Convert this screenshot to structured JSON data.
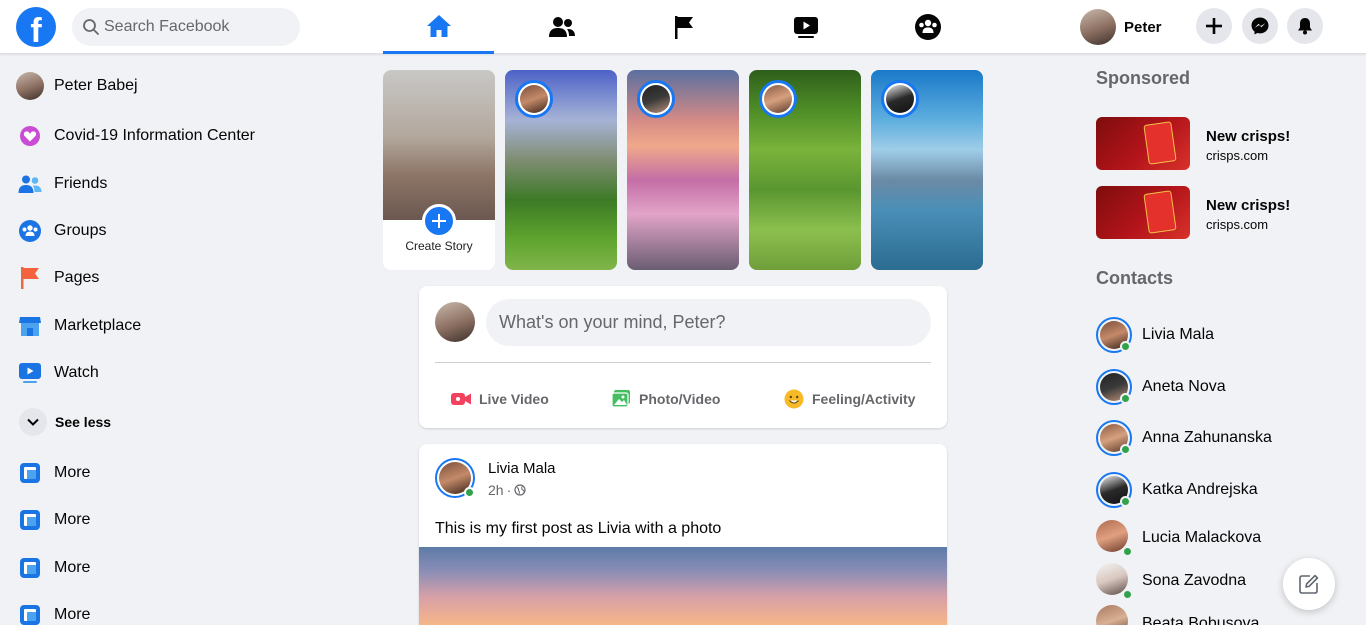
{
  "header": {
    "logo": "f",
    "search_placeholder": "Search Facebook",
    "nav_tabs": [
      {
        "icon": "home-icon",
        "active": true
      },
      {
        "icon": "friends-icon",
        "active": false
      },
      {
        "icon": "pages-flag-icon",
        "active": false
      },
      {
        "icon": "watch-icon",
        "active": false
      },
      {
        "icon": "groups-icon",
        "active": false
      }
    ],
    "profile_name": "Peter",
    "buttons": [
      "create-plus-icon",
      "messenger-icon",
      "notifications-bell-icon"
    ]
  },
  "sidebar": {
    "items": [
      {
        "label": "Peter Babej",
        "icon": "profile-avatar"
      },
      {
        "label": "Covid-19 Information Center",
        "icon": "covid-heart-icon"
      },
      {
        "label": "Friends",
        "icon": "friends-icon"
      },
      {
        "label": "Groups",
        "icon": "groups-icon"
      },
      {
        "label": "Pages",
        "icon": "pages-flag-icon"
      },
      {
        "label": "Marketplace",
        "icon": "marketplace-store-icon"
      },
      {
        "label": "Watch",
        "icon": "watch-icon"
      }
    ],
    "see_less": "See less",
    "more_items": [
      "More",
      "More",
      "More",
      "More"
    ]
  },
  "stories": {
    "create_label": "Create Story"
  },
  "composer": {
    "placeholder": "What's on your mind, Peter?",
    "actions": [
      "Live Video",
      "Photo/Video",
      "Feeling/Activity"
    ]
  },
  "post": {
    "author": "Livia Mala",
    "time": "2h",
    "text": "This is my first post as Livia with a photo"
  },
  "right": {
    "sponsored_heading": "Sponsored",
    "ads": [
      {
        "title": "New crisps!",
        "domain": "crisps.com"
      },
      {
        "title": "New crisps!",
        "domain": "crisps.com"
      }
    ],
    "contacts_heading": "Contacts",
    "contacts": [
      "Livia Mala",
      "Aneta Nova",
      "Anna Zahunanska",
      "Katka Andrejska",
      "Lucia Malackova",
      "Sona Zavodna",
      "Beata Bobusova"
    ]
  },
  "colors": {
    "accent": "#1877f2",
    "background": "#f0f2f5",
    "online": "#31a24c"
  }
}
